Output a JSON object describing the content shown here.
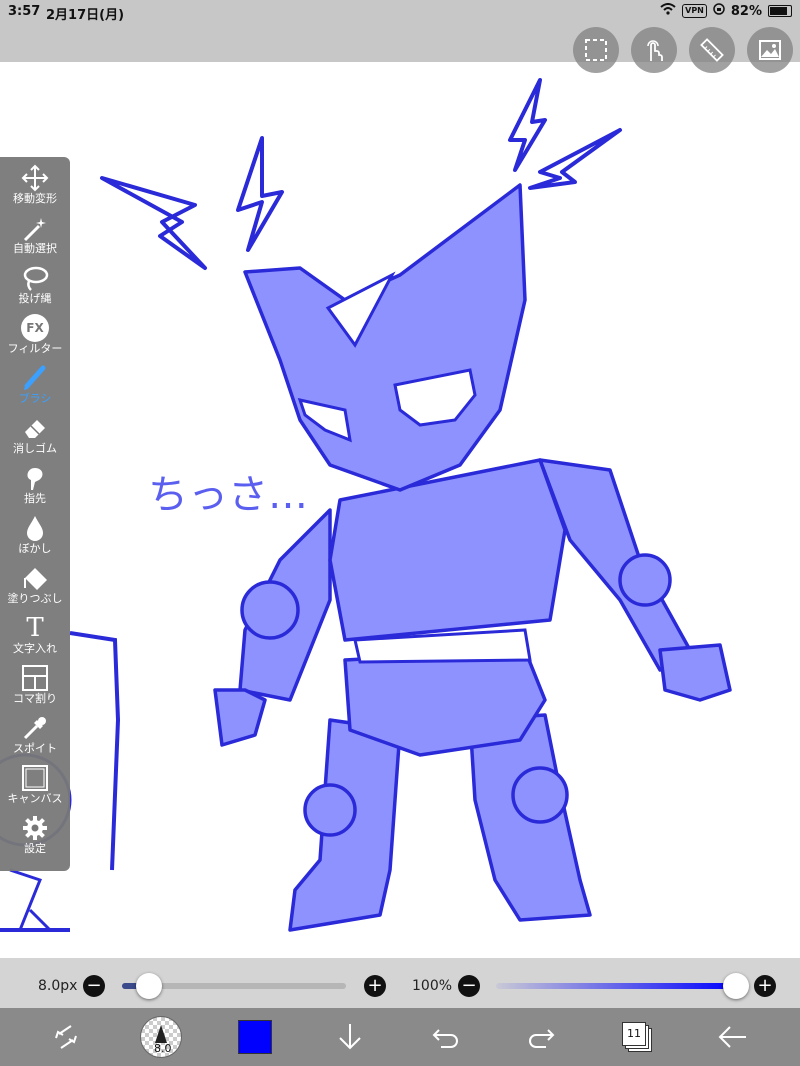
{
  "status": {
    "time": "3:57",
    "date": "2月17日(月)",
    "vpn": "VPN",
    "battery": "82%"
  },
  "top_buttons": [
    "selection-icon",
    "touch-icon",
    "ruler-icon",
    "image-icon"
  ],
  "tools": [
    {
      "label": "移動変形",
      "icon": "move-icon"
    },
    {
      "label": "自動選択",
      "icon": "magic-wand-icon"
    },
    {
      "label": "投げ縄",
      "icon": "lasso-icon"
    },
    {
      "label": "フィルター",
      "icon": "fx-icon",
      "icon_text": "FX"
    },
    {
      "label": "ブラシ",
      "icon": "brush-icon",
      "active": true
    },
    {
      "label": "消しゴム",
      "icon": "eraser-icon"
    },
    {
      "label": "指先",
      "icon": "finger-icon"
    },
    {
      "label": "ぼかし",
      "icon": "blur-icon"
    },
    {
      "label": "塗りつぶし",
      "icon": "fill-icon"
    },
    {
      "label": "文字入れ",
      "icon": "text-icon",
      "icon_text": "T"
    },
    {
      "label": "コマ割り",
      "icon": "frame-icon"
    },
    {
      "label": "スポイト",
      "icon": "eyedropper-icon"
    },
    {
      "label": "キャンバス",
      "icon": "canvas-icon"
    },
    {
      "label": "設定",
      "icon": "gear-icon"
    }
  ],
  "sliders": {
    "size_label": "8.0px",
    "size_minus": "−",
    "size_plus": "+",
    "size_fraction": 0.12,
    "opacity_label": "100%",
    "opacity_minus": "−",
    "opacity_plus": "+",
    "opacity_fraction": 1.0
  },
  "bottom": {
    "brush_size_badge": "8.0",
    "layer_count": "11",
    "current_color": "#0000ff"
  },
  "drawing": {
    "sketch_text": "ちっさ…",
    "stroke_color": "#2a2ad8",
    "fill_color": "#8e92ff"
  }
}
